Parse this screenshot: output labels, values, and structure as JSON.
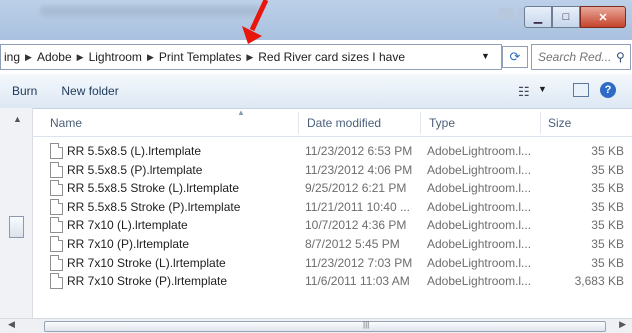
{
  "address": {
    "crumbs": [
      "ing",
      "Adobe",
      "Lightroom",
      "Print Templates",
      "Red River card sizes I have"
    ],
    "search_placeholder": "Search Red..."
  },
  "toolbar": {
    "burn": "Burn",
    "new_folder": "New folder"
  },
  "columns": {
    "name": "Name",
    "date": "Date modified",
    "type": "Type",
    "size": "Size"
  },
  "files": [
    {
      "name": "RR 5.5x8.5 (L).lrtemplate",
      "date": "11/23/2012 6:53 PM",
      "type": "AdobeLightroom.l...",
      "size": "35 KB"
    },
    {
      "name": "RR 5.5x8.5 (P).lrtemplate",
      "date": "11/23/2012 4:06 PM",
      "type": "AdobeLightroom.l...",
      "size": "35 KB"
    },
    {
      "name": "RR 5.5x8.5 Stroke (L).lrtemplate",
      "date": "9/25/2012 6:21 PM",
      "type": "AdobeLightroom.l...",
      "size": "35 KB"
    },
    {
      "name": "RR 5.5x8.5 Stroke (P).lrtemplate",
      "date": "11/21/2011 10:40 ...",
      "type": "AdobeLightroom.l...",
      "size": "35 KB"
    },
    {
      "name": "RR 7x10 (L).lrtemplate",
      "date": "10/7/2012 4:36 PM",
      "type": "AdobeLightroom.l...",
      "size": "35 KB"
    },
    {
      "name": "RR 7x10 (P).lrtemplate",
      "date": "8/7/2012 5:45 PM",
      "type": "AdobeLightroom.l...",
      "size": "35 KB"
    },
    {
      "name": "RR 7x10 Stroke (L).lrtemplate",
      "date": "11/23/2012 7:03 PM",
      "type": "AdobeLightroom.l...",
      "size": "35 KB"
    },
    {
      "name": "RR 7x10 Stroke (P).lrtemplate",
      "date": "11/6/2011 11:03 AM",
      "type": "AdobeLightroom.l...",
      "size": "3,683 KB"
    }
  ],
  "colors": {
    "arrow": "#e8160c",
    "accent": "#2e6bc6"
  }
}
